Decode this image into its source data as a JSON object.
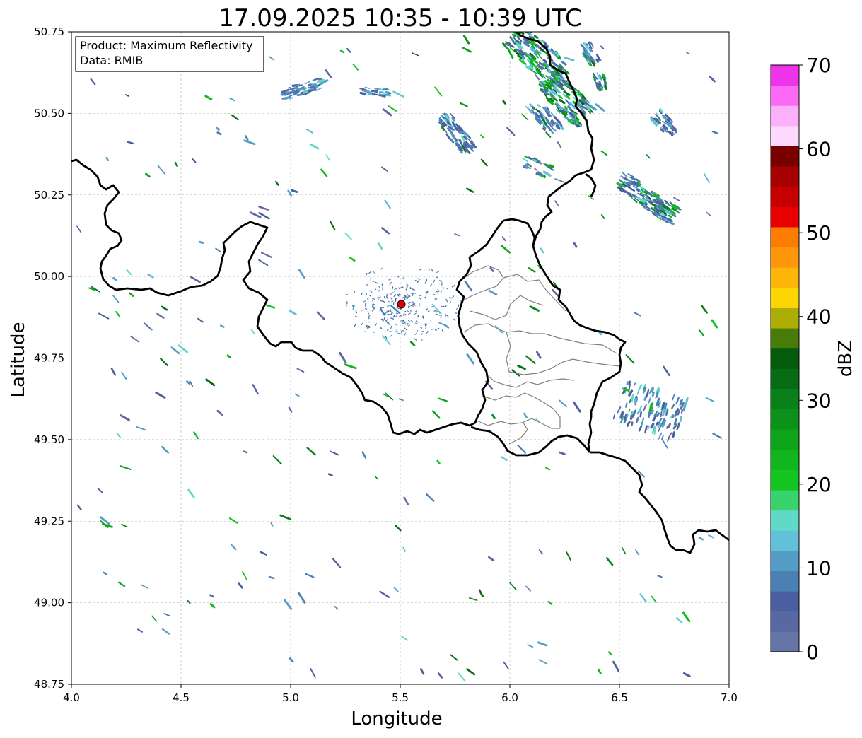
{
  "title": "17.09.2025 10:35 - 10:39 UTC",
  "info_box": {
    "product_line": "Product: Maximum Reflectivity",
    "data_line": "Data: RMIB"
  },
  "axes": {
    "xlabel": "Longitude",
    "ylabel": "Latitude",
    "x_ticks": [
      "4.0",
      "4.5",
      "5.0",
      "5.5",
      "6.0",
      "6.5",
      "7.0"
    ],
    "y_ticks": [
      "50.75",
      "50.50",
      "50.25",
      "50.00",
      "49.75",
      "49.50",
      "49.25",
      "49.00",
      "48.75"
    ],
    "xlim": [
      4.0,
      7.0
    ],
    "ylim": [
      48.75,
      50.75
    ],
    "grid": true
  },
  "colorbar": {
    "label": "dBZ",
    "ticks": [
      "0",
      "10",
      "20",
      "30",
      "40",
      "50",
      "60",
      "70"
    ],
    "range": [
      0,
      70
    ],
    "colors": [
      "#6575a6",
      "#5968a3",
      "#4a5fa0",
      "#4b80b5",
      "#549dc7",
      "#62c0d9",
      "#60d9c6",
      "#3ad26c",
      "#14c522",
      "#11b61c",
      "#0fa51a",
      "#0c921a",
      "#09801a",
      "#076c14",
      "#055a0c",
      "#477c08",
      "#adae04",
      "#fbd604",
      "#fcb508",
      "#fe980a",
      "#fd7c02",
      "#e60000",
      "#c60000",
      "#a70000",
      "#7a0000",
      "#fed8fd",
      "#fcb0fc",
      "#fc6af5",
      "#ee33ea"
    ]
  },
  "radar_site": {
    "lon": 5.505,
    "lat": 49.915,
    "color": "#e00000"
  },
  "border_color": "#000000",
  "internal_border_color": "#808080"
}
